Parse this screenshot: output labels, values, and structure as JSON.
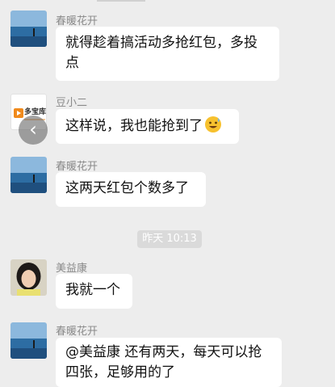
{
  "messages": [
    {
      "sender": "春暖花开",
      "lines": [
        "就得趁着搞活动多抢红包，多投",
        "点"
      ]
    },
    {
      "sender": "豆小二",
      "text": "这样说，我也能抢到了",
      "emoji": "grinning-face-with-sweat"
    },
    {
      "sender": "春暖花开",
      "text": "这两天红包个数多了"
    },
    {
      "sender": "美益康",
      "text": "我就一个"
    },
    {
      "sender": "春暖花开",
      "lines": [
        "@美益康 还有两天，每天可以抢",
        "四张，足够用的了"
      ]
    }
  ],
  "timestamp": "昨天 10:13",
  "logo_text": "多宝库",
  "back_icon": "‹",
  "colors": {
    "background": "#ededed",
    "bubble": "#ffffff",
    "sender": "#8a8a8a",
    "logo_orange": "#f08a1c"
  }
}
